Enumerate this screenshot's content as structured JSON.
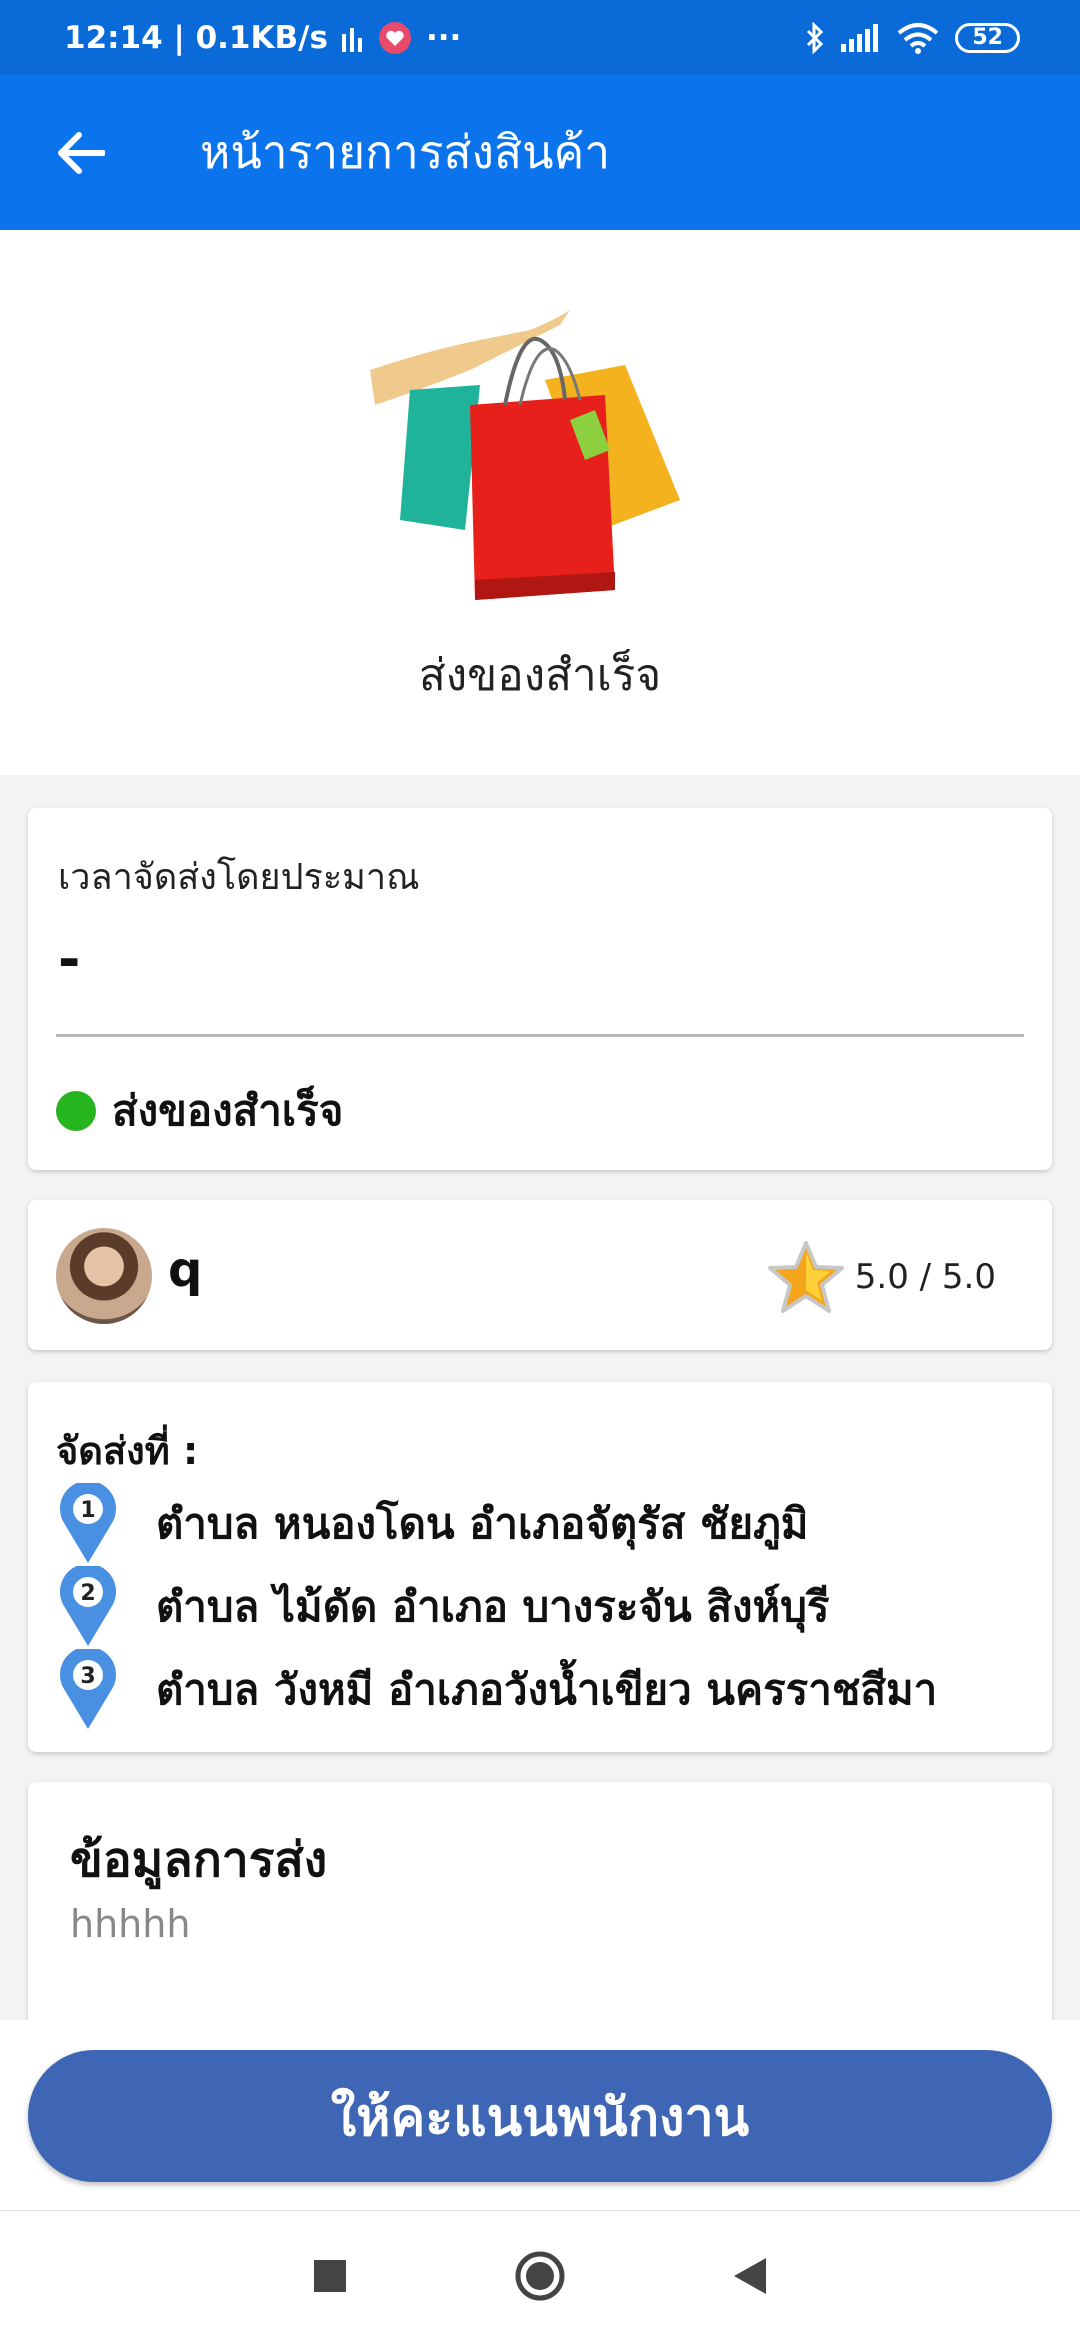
{
  "status_bar": {
    "time_speed": "12:14 | 0.1KB/s",
    "dots": "···",
    "battery": "52"
  },
  "app_bar": {
    "title": "หน้ารายการส่งสินค้า"
  },
  "hero": {
    "status": "ส่งของสำเร็จ"
  },
  "eta": {
    "label": "เวลาจัดส่งโดยประมาณ",
    "value": "-",
    "status": "ส่งของสำเร็จ",
    "status_color": "#26b41f"
  },
  "driver": {
    "name": "q",
    "rating": "5.0 / 5.0"
  },
  "route": {
    "heading": "จัดส่งที่ :",
    "stops": [
      {
        "num": "1",
        "text": "ตำบล หนองโดน อำเภอจัตุรัส ชัยภูมิ"
      },
      {
        "num": "2",
        "text": "ตำบล ไม้ดัด อำเภอ บางระจัน สิงห์บุรี"
      },
      {
        "num": "3",
        "text": "ตำบล วังหมี อำเภอวังน้ำเขียว นครราชสีมา"
      }
    ]
  },
  "info": {
    "title": "ข้อมูลการส่ง",
    "body": "hhhhh"
  },
  "actions": {
    "rate_button": "ให้คะแนนพนักงาน"
  },
  "colors": {
    "app_bar": "#0b74ec",
    "button": "#3e66b4",
    "pin": "#4a90e2"
  }
}
